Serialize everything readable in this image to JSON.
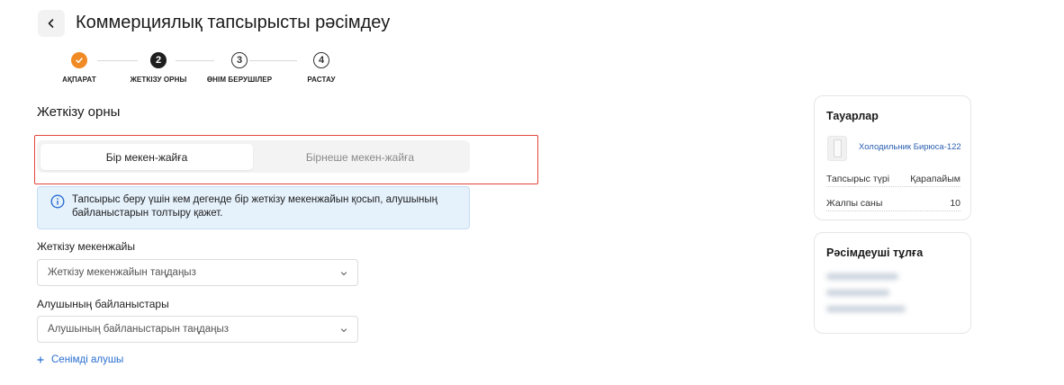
{
  "header": {
    "back_icon": "chevron-left-icon",
    "title": "Коммерциялық тапсырысты рәсімдеу"
  },
  "stepper": {
    "steps": [
      {
        "number": "✓",
        "label": "АҚПАРАТ",
        "status": "done"
      },
      {
        "number": "2",
        "label": "ЖЕТКІЗУ ОРНЫ",
        "status": "current"
      },
      {
        "number": "3",
        "label": "ӨНІМ БЕРУШІЛЕР",
        "status": "todo"
      },
      {
        "number": "4",
        "label": "РАСТАУ",
        "status": "todo"
      }
    ],
    "done_color": "#f08a24",
    "current_color": "#1f1f1f"
  },
  "section": {
    "title": "Жеткізу орны",
    "tabs": [
      {
        "label": "Бір мекен-жайға",
        "active": true
      },
      {
        "label": "Бірнеше мекен-жайға",
        "active": false
      }
    ],
    "highlight_color": "#e2453b"
  },
  "info": {
    "icon": "info-circle-icon",
    "text": "Тапсырыс беру үшін кем дегенде бір жеткізу мекенжайын қосып, алушының байланыстарын толтыру қажет."
  },
  "form": {
    "address_label": "Жеткізу мекенжайы",
    "address_placeholder": "Жеткізу мекенжайын таңдаңыз",
    "contacts_label": "Алушының байланыстары",
    "contacts_placeholder": "Алушының байланыстарын таңдаңыз",
    "add_trusted_label": "Сенімді алушы",
    "add_icon": "plus-icon",
    "link_color": "#2a6fd1"
  },
  "goods_card": {
    "title": "Тауарлар",
    "product_name": "Холодильник Бирюса-122",
    "order_type_label": "Тапсырыс түрі",
    "order_type_value": "Қарапайым",
    "total_label": "Жалпы саны",
    "total_value": "10"
  },
  "applicant_card": {
    "title": "Рәсімдеуші тұлға"
  }
}
